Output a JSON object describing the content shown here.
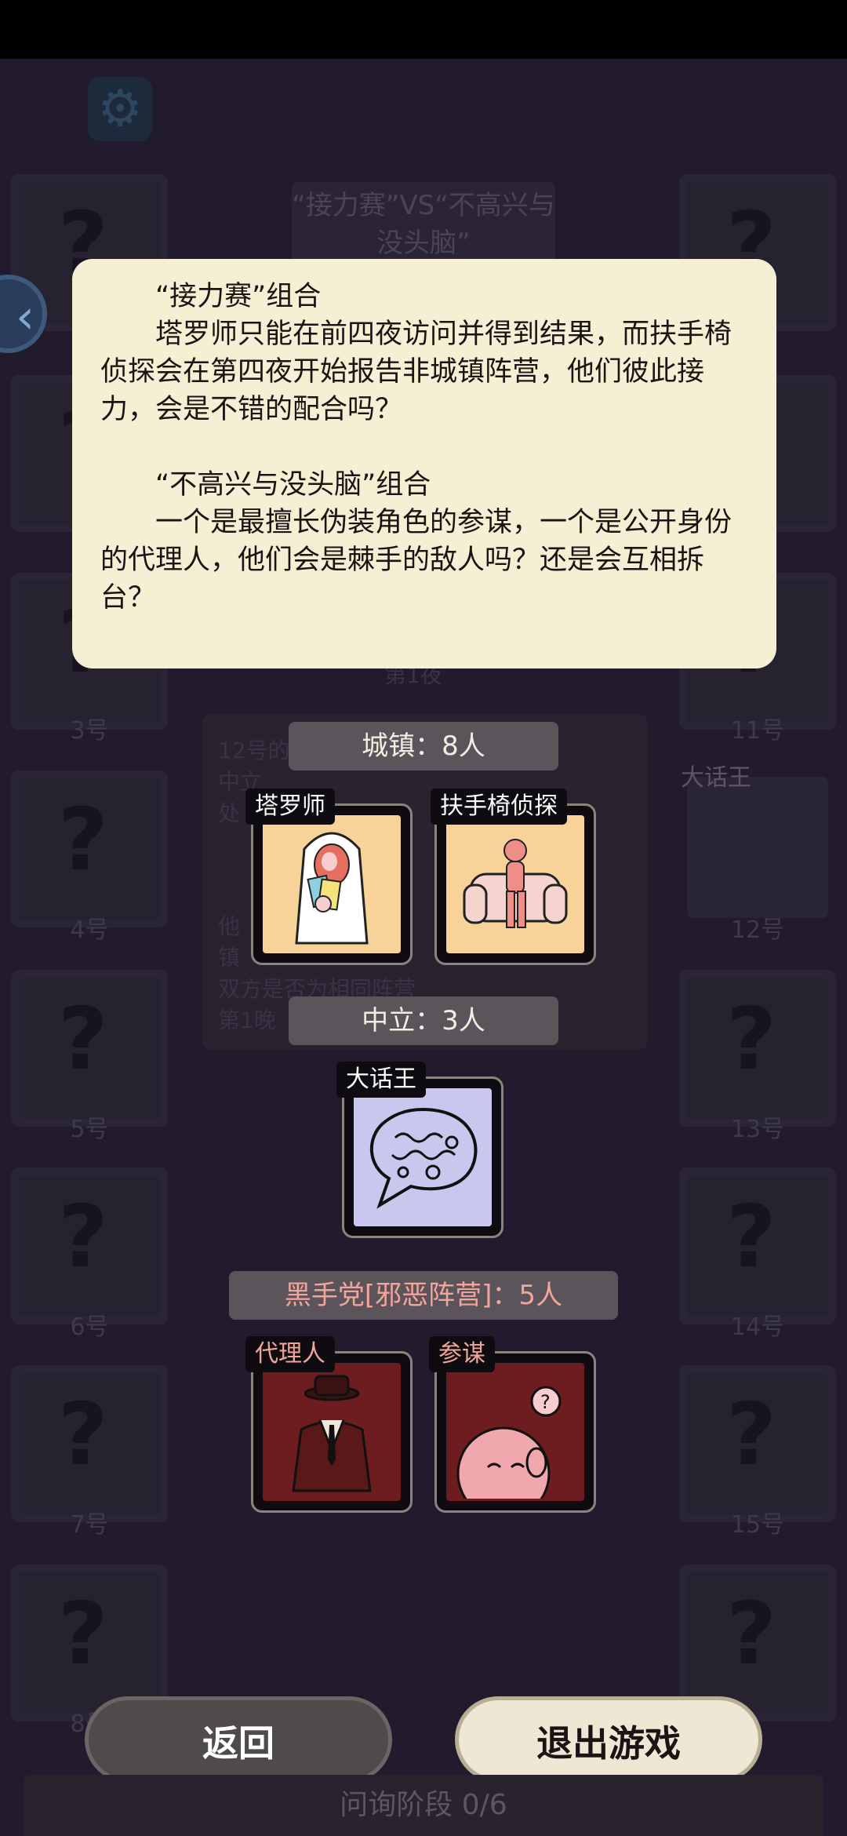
{
  "header": {
    "matchup_title": "“接力赛”VS“不高兴与没头脑”"
  },
  "modal": {
    "group1_title": "“接力赛”组合",
    "group1_text": "塔罗师只能在前四夜访问并得到结果，而扶手椅侦探会在第四夜开始报告非城镇阵营，他们彼此接力，会是不错的配合吗？",
    "group2_title": "“不高兴与没头脑”组合",
    "group2_text": "一个是最擅长伪装角色的参谋，一个是公开身份的代理人，他们会是棘手的敌人吗？还是会互相拆台？"
  },
  "background": {
    "left_slots": [
      "3号",
      "4号",
      "5号",
      "6号",
      "7号",
      "8号"
    ],
    "right_slots": [
      "11号",
      "12号",
      "13号",
      "14号",
      "15号"
    ],
    "right_slot_12_role": "大话王",
    "info_snippets": [
      "第1夜",
      "12号的",
      "中立",
      "处",
      "他",
      "镇",
      "双方是否为相同阵营",
      "第1晚"
    ]
  },
  "teams": [
    {
      "name": "城镇：8人",
      "color": "#f3ece0",
      "roles": [
        {
          "name": "塔罗师",
          "art_icon": "tarot-reader-icon",
          "bg": "#f7d39a"
        },
        {
          "name": "扶手椅侦探",
          "art_icon": "armchair-detective-icon",
          "bg": "#f7d39a"
        }
      ]
    },
    {
      "name": "中立：3人",
      "color": "#f3ece0",
      "roles": [
        {
          "name": "大话王",
          "art_icon": "speech-bubble-icon",
          "bg": "#c8c7ee"
        }
      ]
    },
    {
      "name": "黑手党[邪恶阵营]：5人",
      "color": "#f2a59a",
      "roles": [
        {
          "name": "代理人",
          "art_icon": "suit-man-icon",
          "bg": "#6d1d1f"
        },
        {
          "name": "参谋",
          "art_icon": "strategist-face-icon",
          "bg": "#6d1d1f"
        }
      ]
    }
  ],
  "buttons": {
    "back": "返回",
    "exit": "退出游戏"
  },
  "phase": "问询阶段 0/6"
}
